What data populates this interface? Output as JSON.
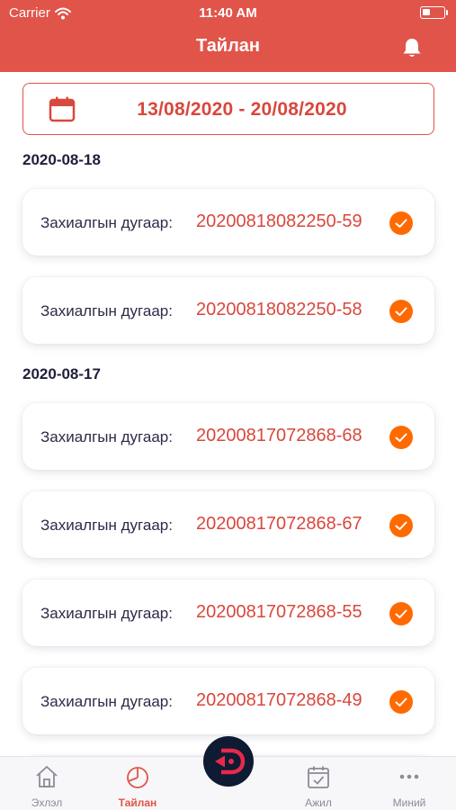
{
  "status_bar": {
    "carrier": "Carrier",
    "time": "11:40 AM"
  },
  "header": {
    "title": "Тайлан",
    "bell_icon": "bell-icon"
  },
  "date_range": {
    "text": "13/08/2020 - 20/08/2020",
    "icon": "calendar-icon"
  },
  "groups": [
    {
      "date": "2020-08-18",
      "orders": [
        {
          "label": "Захиалгын дугаар:",
          "number": "20200818082250-59",
          "status": "completed"
        },
        {
          "label": "Захиалгын дугаар:",
          "number": "20200818082250-58",
          "status": "completed"
        }
      ]
    },
    {
      "date": "2020-08-17",
      "orders": [
        {
          "label": "Захиалгын дугаар:",
          "number": "20200817072868-68",
          "status": "completed"
        },
        {
          "label": "Захиалгын дугаар:",
          "number": "20200817072868-67",
          "status": "completed"
        },
        {
          "label": "Захиалгын дугаар:",
          "number": "20200817072868-55",
          "status": "completed"
        },
        {
          "label": "Захиалгын дугаар:",
          "number": "20200817072868-49",
          "status": "completed"
        }
      ]
    }
  ],
  "tabbar": {
    "home": "Эхлэл",
    "report": "Тайлан",
    "center_icon": "brand-logo-icon",
    "jobs": "Ажил",
    "mine": "Миний"
  },
  "colors": {
    "accent": "#E0544A",
    "check": "#FF6A00",
    "navy": "#0e1b33"
  }
}
